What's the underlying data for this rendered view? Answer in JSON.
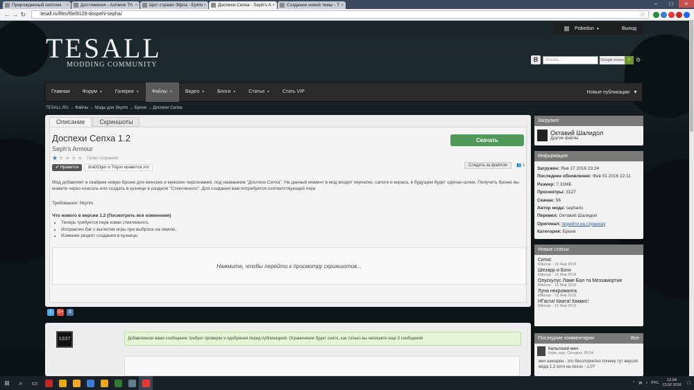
{
  "browser": {
    "tabs": [
      {
        "title": "Прирожденный охотник",
        "active": false
      },
      {
        "title": "Достижения - Achieve Th",
        "active": false
      },
      {
        "title": "Щит стражи Эфла - Ephlo",
        "active": false
      },
      {
        "title": "Доспехи Сепха - Seph's A",
        "active": true
      },
      {
        "title": "Создание новой темы - T",
        "active": false
      }
    ],
    "url": "tesall.ru/files/file/8129-dospehi-sepha/",
    "ext_colors": [
      "#2a8c3c",
      "#3a7bd5",
      "#e53935",
      "#c62828",
      "#2962ff"
    ]
  },
  "site": {
    "logo": "TESALL",
    "logo_sub": "MODDING COMMUNITY",
    "user": "Pobedun",
    "logout": "Выход",
    "search_placeholder": "Искать...",
    "search_engine": "Google поиск",
    "nav": [
      {
        "label": "Главная",
        "dropdown": false,
        "active": false
      },
      {
        "label": "Форум",
        "dropdown": true,
        "active": false
      },
      {
        "label": "Галерея",
        "dropdown": true,
        "active": false
      },
      {
        "label": "Файлы",
        "dropdown": true,
        "active": true
      },
      {
        "label": "Видео",
        "dropdown": true,
        "active": false
      },
      {
        "label": "Блоги",
        "dropdown": true,
        "active": false
      },
      {
        "label": "Статьи",
        "dropdown": true,
        "active": false
      },
      {
        "label": "Стать VIP",
        "dropdown": false,
        "active": false
      }
    ],
    "new_posts": "Новые публикации"
  },
  "breadcrumb": "TESALL.RU → Файлы → Моды для Skyrim → Броня → Доспехи Сепха",
  "file": {
    "tab_desc": "Описание",
    "tab_shots": "Скриншоты",
    "title": "Доспехи Сепха 1.2",
    "subtitle": "Seph's Armour",
    "rating": 1,
    "rating_max": 5,
    "rating_text": "Голос сохранен!",
    "like_btn": "Нравится",
    "likes_text": "draOOger и Trigon нравится это",
    "download": "Скачать",
    "follow": "Следить за файлом",
    "followers": "1",
    "description": "Мод добавляет в скайрим новую броню для женских и мужских персонажей, под названием \"Доспехи Сепха\". На данный момент в мод входят перчатки, сапоги и кираса, в будущем будет сделан шлем. Получить броню вы можете через консоль или создать в кузнице в разделе \"Стеклянного\". Для создания вам потребуется соответствующий перк",
    "requirements": "Требования: Skyrim.",
    "whats_new": "Что нового в версии 1.2 (Посмотреть все изменения)",
    "changes": [
      "Теперь требуется перк ковки стеклянного.",
      "Исправлен баг с вылетом игры при выбросе на землю.",
      "Изменен рецепт создания в кузнице."
    ],
    "screens_link": "Нажмите, чтобы перейти к просмотру скриншотов..."
  },
  "comment": {
    "avatar_text": "1337",
    "notice": "Добавленное вами сообщение требует проверки и одобрения перед публикацией. Ограничение будет снято, как только вы напишете еще 3 сообщений"
  },
  "sidebar": {
    "uploader_title": "Загрузил:",
    "uploader_name": "Октавий Шалидол",
    "other_files": "Другие файлы",
    "info_title": "Информация",
    "info": {
      "loaded_label": "Загружен:",
      "loaded": "Янв 27 2016 23:24",
      "updated_label": "Последнее обновление:",
      "updated": "Фев 01 2016 22:11",
      "size_label": "Размер:",
      "size": "7.31МБ",
      "views_label": "Просмотры:",
      "views": "3127",
      "downloads_label": "Скачан:",
      "downloads": "56",
      "author_label": "Автор мода:",
      "author": "sepharis",
      "translator_label": "Перевел:",
      "translator": "Октавий Шалидол",
      "original_label": "Оригинал:",
      "original": "перейти на страницу",
      "category_label": "Категория:",
      "category": "Броня"
    },
    "articles_title": "Новые статьи",
    "articles": [
      {
        "title": "Ситис",
        "meta": "Mikezar - 16 Янв 2016"
      },
      {
        "title": "Шезарр и Боги",
        "meta": "Mikezar - 16 Янв 2016"
      },
      {
        "title": "Опускулус Ламе Бал та Меззамортие",
        "meta": "Mikezar - 16 Янв 2016"
      },
      {
        "title": "Луна некроманта",
        "meta": "Mikezar - 16 Янв 2016"
      },
      {
        "title": "НГаста! Квата! Квакис!",
        "meta": "Mikezar - 16 Янв 2016"
      }
    ],
    "comments_title": "Последние комментарии",
    "comments_all": "Все",
    "last_comment": {
      "title": "Кельтский меч",
      "meta": "triple_ego, Сегодня, 05:54",
      "text": "меч шикарен - это бесспорно!но почему тут версия мода 1.2 хотя на nexus - 1.0?"
    }
  },
  "taskbar": {
    "colors": [
      "#c62828",
      "#e6a817",
      "#f9a825",
      "#3a7bd5",
      "#e6a817",
      "#2e7d32",
      "#607d8b",
      "#e53935"
    ],
    "lang": "РУС",
    "time": "12:04",
    "date": "13.02.2016"
  }
}
